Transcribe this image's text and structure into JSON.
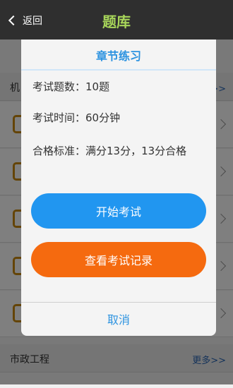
{
  "header": {
    "back_label": "返回",
    "title": "题库"
  },
  "background_list": {
    "section_top": {
      "name_fragment": "机",
      "more_fragment": "多>>"
    },
    "section_bottom": {
      "name": "市政工程",
      "more": "更多>>"
    }
  },
  "modal": {
    "title": "章节练习",
    "question_count": "考试题数：10题",
    "exam_time": "考试时间：60分钟",
    "pass_standard": "合格标准：满分13分，13分合格",
    "start_button": "开始考试",
    "records_button": "查看考试记录",
    "cancel_button": "取消"
  },
  "colors": {
    "header_bg": "#2f2f2f",
    "title_green": "#a8d65a",
    "accent_blue": "#2196f0",
    "accent_orange": "#f56a0f"
  }
}
